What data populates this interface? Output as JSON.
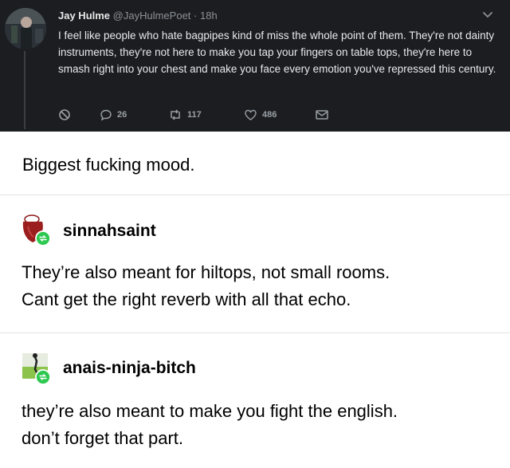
{
  "tweet": {
    "author_name": "Jay Hulme",
    "author_handle": "@JayHulmePoet",
    "time": "· 18h",
    "text": "I feel like people who hate bagpipes kind of miss the whole point of them. They're not dainty instruments, they're not here to make you tap your fingers on table tops, they're here to smash right into your chest and make you face every emotion you've repressed this century.",
    "replies": "26",
    "retweets": "117",
    "likes": "486"
  },
  "op": {
    "comment": "Biggest fucking mood."
  },
  "reblogs": [
    {
      "username": "sinnahsaint",
      "lines": [
        "They’re also meant for hiltops, not small rooms.",
        "Cant get the right reverb with all that echo."
      ]
    },
    {
      "username": "anais-ninja-bitch",
      "lines": [
        "they’re also meant to make you fight the english.",
        "don’t forget that part."
      ]
    }
  ],
  "colors": {
    "tweet_bg": "#1b1d21",
    "reblog_badge": "#2cc84f",
    "divider": "#e2e2e2"
  }
}
